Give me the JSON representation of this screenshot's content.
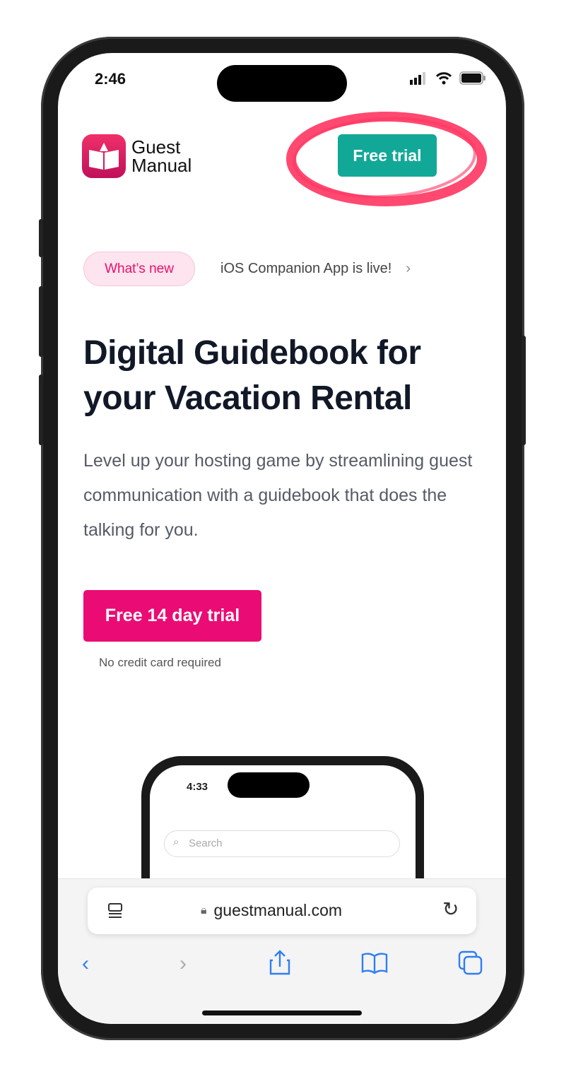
{
  "status_bar": {
    "time": "2:46"
  },
  "header": {
    "logo_line1": "Guest",
    "logo_line2": "Manual",
    "free_trial": "Free trial"
  },
  "announcement": {
    "badge": "What’s new",
    "text": "iOS Companion App is live!"
  },
  "hero": {
    "title": "Digital Guidebook for your Vacation Rental",
    "subtitle": "Level up your hosting game by streamlining guest communication with a guidebook that does the talking for you.",
    "cta": "Free 14 day trial",
    "note": "No credit card required"
  },
  "preview": {
    "time": "4:33",
    "search_placeholder": "Search"
  },
  "browser": {
    "url": "guestmanual.com"
  },
  "colors": {
    "accent": "#ea0c74",
    "trial_button": "#12a898",
    "highlight_circle": "#ff3560"
  }
}
